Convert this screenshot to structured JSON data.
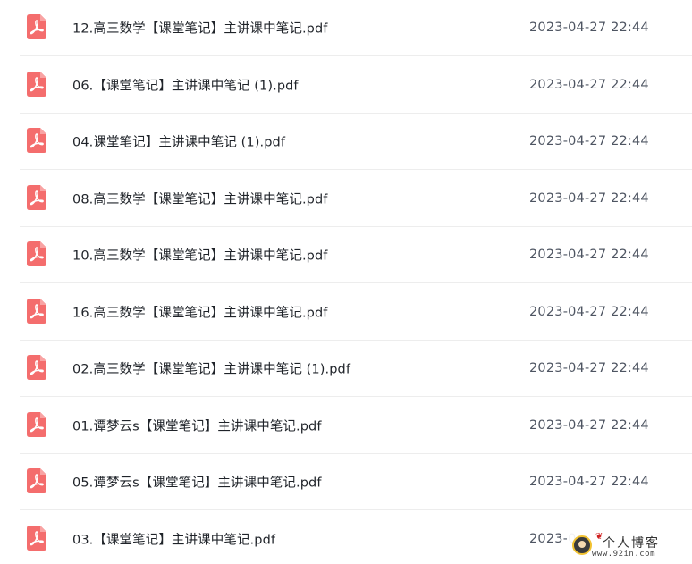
{
  "files": [
    {
      "name": "12.高三数学【课堂笔记】主讲课中笔记.pdf",
      "date": "2023-04-27 22:44",
      "icon": "pdf-icon"
    },
    {
      "name": "06.【课堂笔记】主讲课中笔记 (1).pdf",
      "date": "2023-04-27 22:44",
      "icon": "pdf-icon"
    },
    {
      "name": "04.课堂笔记】主讲课中笔记 (1).pdf",
      "date": "2023-04-27 22:44",
      "icon": "pdf-icon"
    },
    {
      "name": "08.高三数学【课堂笔记】主讲课中笔记.pdf",
      "date": "2023-04-27 22:44",
      "icon": "pdf-icon"
    },
    {
      "name": "10.高三数学【课堂笔记】主讲课中笔记.pdf",
      "date": "2023-04-27 22:44",
      "icon": "pdf-icon"
    },
    {
      "name": "16.高三数学【课堂笔记】主讲课中笔记.pdf",
      "date": "2023-04-27 22:44",
      "icon": "pdf-icon"
    },
    {
      "name": "02.高三数学【课堂笔记】主讲课中笔记 (1).pdf",
      "date": "2023-04-27 22:44",
      "icon": "pdf-icon"
    },
    {
      "name": "01.谭梦云s【课堂笔记】主讲课中笔记.pdf",
      "date": "2023-04-27 22:44",
      "icon": "pdf-icon"
    },
    {
      "name": "05.谭梦云s【课堂笔记】主讲课中笔记.pdf",
      "date": "2023-04-27 22:44",
      "icon": "pdf-icon"
    },
    {
      "name": "03.【课堂笔记】主讲课中笔记.pdf",
      "date": "2023-0",
      "icon": "pdf-icon"
    }
  ],
  "watermark": {
    "title": "个人博客",
    "url": "www.92in.com"
  },
  "colors": {
    "pdf_icon": "#f46d6d",
    "divider": "#ededed",
    "file_name_text": "#1f2329",
    "date_text": "#4e5562"
  }
}
